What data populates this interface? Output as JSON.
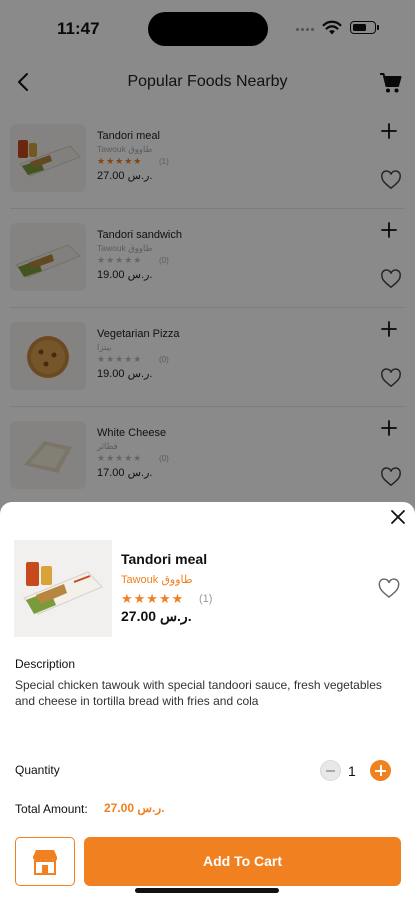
{
  "status_bar": {
    "time": "11:47"
  },
  "header": {
    "title": "Popular Foods Nearby"
  },
  "foods": [
    {
      "name": "Tandori meal",
      "subtitle": "Tawouk طاووق",
      "stars": "★★★★★",
      "star_count": "(1)",
      "price": "27.00 ر.س.",
      "rated": true
    },
    {
      "name": "Tandori sandwich",
      "subtitle": "Tawouk طاووق",
      "stars": "★★★★★",
      "star_count": "(0)",
      "price": "19.00 ر.س.",
      "rated": false
    },
    {
      "name": "Vegetarian Pizza",
      "subtitle": "بيتزا",
      "stars": "★★★★★",
      "star_count": "(0)",
      "price": "19.00 ر.س.",
      "rated": false
    },
    {
      "name": "White Cheese",
      "subtitle": "فطائر",
      "stars": "★★★★★",
      "star_count": "(0)",
      "price": "17.00 ر.س.",
      "rated": false
    }
  ],
  "detail": {
    "name": "Tandori meal",
    "subtitle": "Tawouk طاووق",
    "stars": "★★★★★",
    "star_count": "(1)",
    "price": "27.00 ر.س.",
    "description_title": "Description",
    "description": "Special chicken tawouk with special tandoori sauce, fresh vegetables and cheese in tortilla bread with fries and cola",
    "quantity_label": "Quantity",
    "quantity": "1",
    "total_label": "Total Amount:",
    "total_value": "27.00 ر.س.",
    "add_to_cart_label": "Add To Cart"
  },
  "colors": {
    "accent": "#f08020",
    "overlay": "rgba(0,0,0,0.46)"
  },
  "icons": [
    "back-icon",
    "cart-icon",
    "plus-icon",
    "heart-icon",
    "close-icon",
    "minus-icon",
    "store-icon",
    "wifi-icon",
    "battery-icon"
  ]
}
